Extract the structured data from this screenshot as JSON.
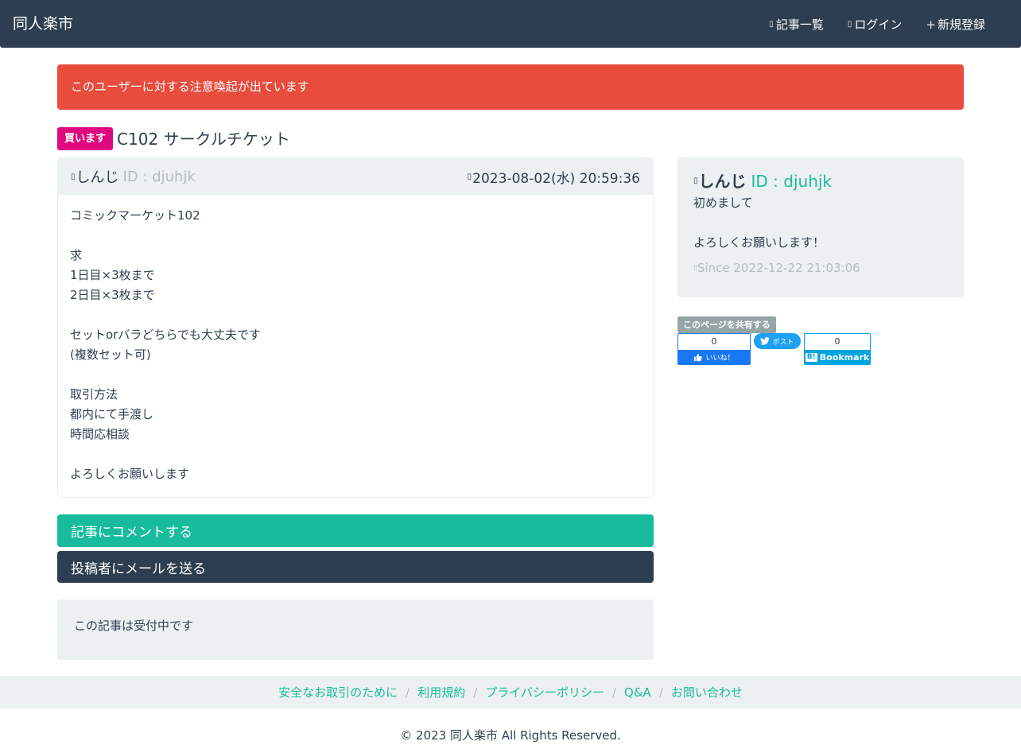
{
  "navbar": {
    "brand": "同人楽市",
    "links": [
      {
        "icon": "list-icon",
        "label": "記事一覧",
        "glyph": "▯"
      },
      {
        "icon": "login-icon",
        "label": "ログイン",
        "glyph": "▯"
      },
      {
        "icon": "plus-icon",
        "label": "新規登録",
        "glyph": "+"
      }
    ]
  },
  "alert": {
    "text": "このユーザーに対する注意喚起が出ています"
  },
  "post": {
    "badge": "買います",
    "title": "C102 サークルチケット",
    "author_name": "しんじ",
    "author_id": "ID : djuhjk",
    "date": "2023-08-02(水) 20:59:36",
    "body_lines": [
      "コミックマーケット102",
      "",
      "求",
      "1日目×3枚まで",
      "2日目×3枚まで",
      "",
      "セットorバラどちらでも大丈夫です",
      "(複数セット可)",
      "",
      "取引方法",
      "都内にて手渡し",
      "時間応相談",
      "",
      "よろしくお願いします"
    ]
  },
  "actions": {
    "comment": "記事にコメントする",
    "mail": "投稿者にメールを送る"
  },
  "status": {
    "text": "この記事は受付中です"
  },
  "profile": {
    "name": "しんじ",
    "id": "ID : djuhjk",
    "bio_lines": [
      "初めまして",
      "",
      "よろしくお願いします！"
    ],
    "since": "Since 2022-12-22 21:03:06"
  },
  "share": {
    "label": "このページを共有する",
    "facebook": {
      "count": "0",
      "label": "いいね！"
    },
    "twitter": {
      "label": "ポスト"
    },
    "hatena": {
      "count": "0",
      "label": "Bookmark"
    }
  },
  "footer": {
    "links": [
      "安全なお取引のために",
      "利用規約",
      "プライバシーポリシー",
      "Q&A",
      "お問い合わせ"
    ],
    "copyright": "© 2023 同人楽市 All Rights Reserved."
  },
  "colors": {
    "navbar": "#2c3e50",
    "alert": "#e74c3c",
    "badge": "#e0087e",
    "accent": "#18bc9c",
    "muted": "#b4bcc2",
    "panel": "#ecf0f1"
  }
}
